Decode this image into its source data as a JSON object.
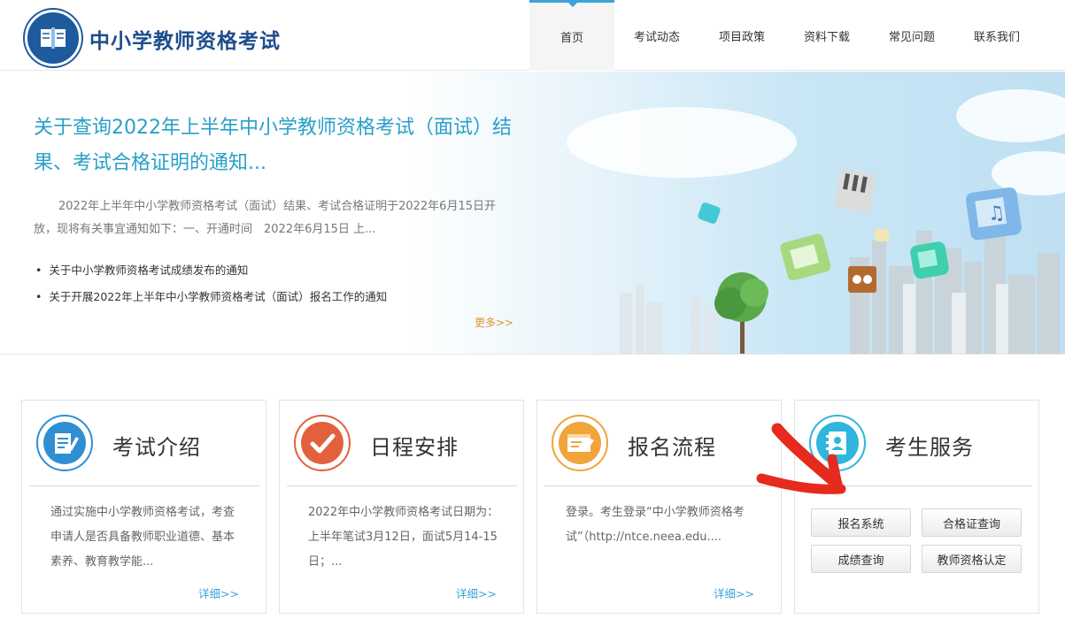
{
  "header": {
    "site_title": "中小学教师资格考试",
    "nav": [
      "首页",
      "考试动态",
      "项目政策",
      "资料下载",
      "常见问题",
      "联系我们"
    ],
    "active_nav": "首页"
  },
  "banner": {
    "title": "关于查询2022年上半年中小学教师资格考试（面试）结果、考试合格证明的通知...",
    "description": "2022年上半年中小学教师资格考试（面试）结果、考试合格证明于2022年6月15日开放，现将有关事宜通知如下：一、开通时间　2022年6月15日 上...",
    "links": [
      "关于中小学教师资格考试成绩发布的通知",
      "关于开展2022年上半年中小学教师资格考试（面试）报名工作的通知"
    ],
    "more": "更多>>"
  },
  "cards": [
    {
      "title": "考试介绍",
      "text": "通过实施中小学教师资格考试，考查申请人是否具备教师职业道德、基本素养、教育教学能...",
      "more": "详细>>",
      "icon": "exam-intro-icon",
      "color": "#2f8fd3"
    },
    {
      "title": "日程安排",
      "text": "2022年中小学教师资格考试日期为：上半年笔试3月12日，面试5月14-15日；...",
      "more": "详细>>",
      "icon": "checkmark-icon",
      "color": "#e2613c"
    },
    {
      "title": "报名流程",
      "text": "登录。考生登录“中小学教师资格考试”（http://ntce.neea.edu....",
      "more": "详细>>",
      "icon": "registration-form-icon",
      "color": "#f0a43a"
    }
  ],
  "services": {
    "title": "考生服务",
    "icon": "student-services-icon",
    "color": "#2eb6dd",
    "buttons": [
      "报名系统",
      "合格证查询",
      "成绩查询",
      "教师资格认定"
    ]
  }
}
